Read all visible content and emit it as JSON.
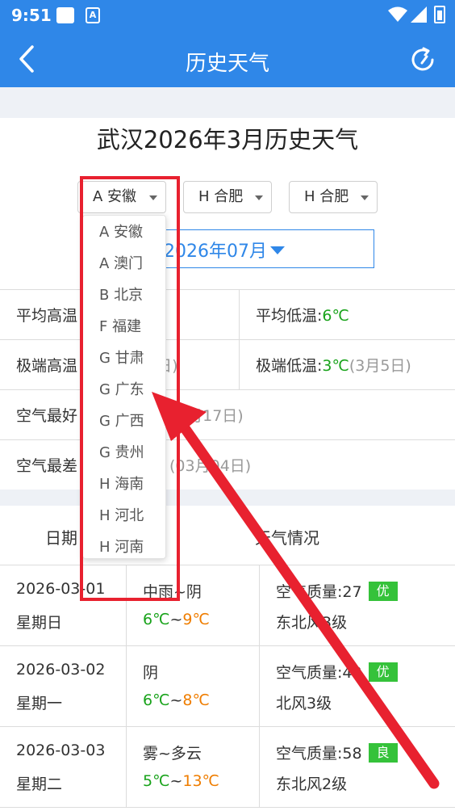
{
  "status_bar": {
    "time": "9:51",
    "notif_icon_letter": "A"
  },
  "nav": {
    "title": "历史天气"
  },
  "heading": "武汉2026年3月历史天气",
  "selects": [
    {
      "label": "A 安徽"
    },
    {
      "label": "H 合肥"
    },
    {
      "label": "H 合肥"
    }
  ],
  "month_picker": {
    "value": "2026年07月"
  },
  "stats": {
    "avg_high_label": "平均高温",
    "avg_low_label": "平均低温:",
    "avg_low_value": "6℃",
    "extreme_high_label": "极端高温",
    "extreme_high_date": "4日)",
    "extreme_low_label": "极端低温:",
    "extreme_low_value": "3℃",
    "extreme_low_date": "(3月5日)",
    "best_air_label": "空气最好",
    "best_air_date": "3月17日)",
    "worst_air_label": "空气最差",
    "worst_air_date": "(03月04日)"
  },
  "table": {
    "col_date": "日期",
    "col_weather": "天气情况",
    "rows": [
      {
        "date": "2026-03-01",
        "weekday": "星期日",
        "condition": "中雨~阴",
        "low": "6℃",
        "sep": "~",
        "high": "9℃",
        "aqi": "空气质量:27",
        "aqi_level": "优",
        "wind": "东北风3级"
      },
      {
        "date": "2026-03-02",
        "weekday": "星期一",
        "condition": "阴",
        "low": "6℃",
        "sep": "~",
        "high": "8℃",
        "aqi": "空气质量:43",
        "aqi_level": "优",
        "wind": "北风3级"
      },
      {
        "date": "2026-03-03",
        "weekday": "星期二",
        "condition": "雾~多云",
        "low": "5℃",
        "sep": "~",
        "high": "13℃",
        "aqi": "空气质量:58",
        "aqi_level": "良",
        "wind": "东北风2级"
      }
    ]
  },
  "dropdown": {
    "options": [
      "A 安徽",
      "A 澳门",
      "B 北京",
      "F 福建",
      "G 甘肃",
      "G 广东",
      "G 广西",
      "G 贵州",
      "H 海南",
      "H 河北",
      "H 河南"
    ]
  },
  "colors": {
    "brand": "#2f87e8",
    "annotation_red": "#e8212f",
    "temp_low": "#19a31b",
    "temp_high": "#ef7d00",
    "badge_green": "#35c23a"
  }
}
